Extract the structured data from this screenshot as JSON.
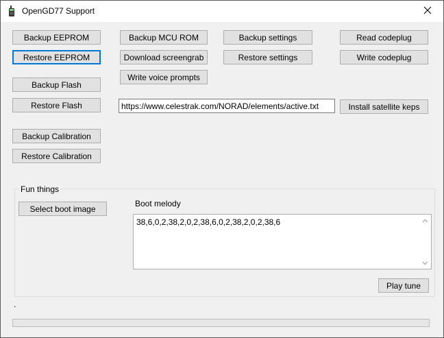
{
  "window": {
    "title": "OpenGD77 Support"
  },
  "buttons": {
    "backup_eeprom": "Backup EEPROM",
    "restore_eeprom": "Restore EEPROM",
    "backup_flash": "Backup Flash",
    "restore_flash": "Restore Flash",
    "backup_calibration": "Backup Calibration",
    "restore_calibration": "Restore Calibration",
    "backup_mcu_rom": "Backup MCU ROM",
    "download_screengrab": "Download screengrab",
    "write_voice_prompts": "Write voice prompts",
    "backup_settings": "Backup settings",
    "restore_settings": "Restore settings",
    "read_codeplug": "Read codeplug",
    "write_codeplug": "Write codeplug",
    "install_satellite_keps": "Install satellite keps"
  },
  "keps_url": {
    "value": "https://www.celestrak.com/NORAD/elements/active.txt"
  },
  "fun_things": {
    "group_label": "Fun things",
    "select_boot_image": "Select boot image",
    "boot_melody_label": "Boot melody",
    "boot_melody_value": "38,6,0,2,38,2,0,2,38,6,0,2,38,2,0,2,38,6",
    "play_tune": "Play tune"
  },
  "status": {
    "text": "."
  },
  "progress": {
    "value": 0
  },
  "colors": {
    "window_bg": "#f0f0f0",
    "button_bg": "#e1e1e1",
    "focus_accent": "#0078d7"
  },
  "icons": {
    "app": "radio-handset-icon",
    "close": "close-icon"
  }
}
